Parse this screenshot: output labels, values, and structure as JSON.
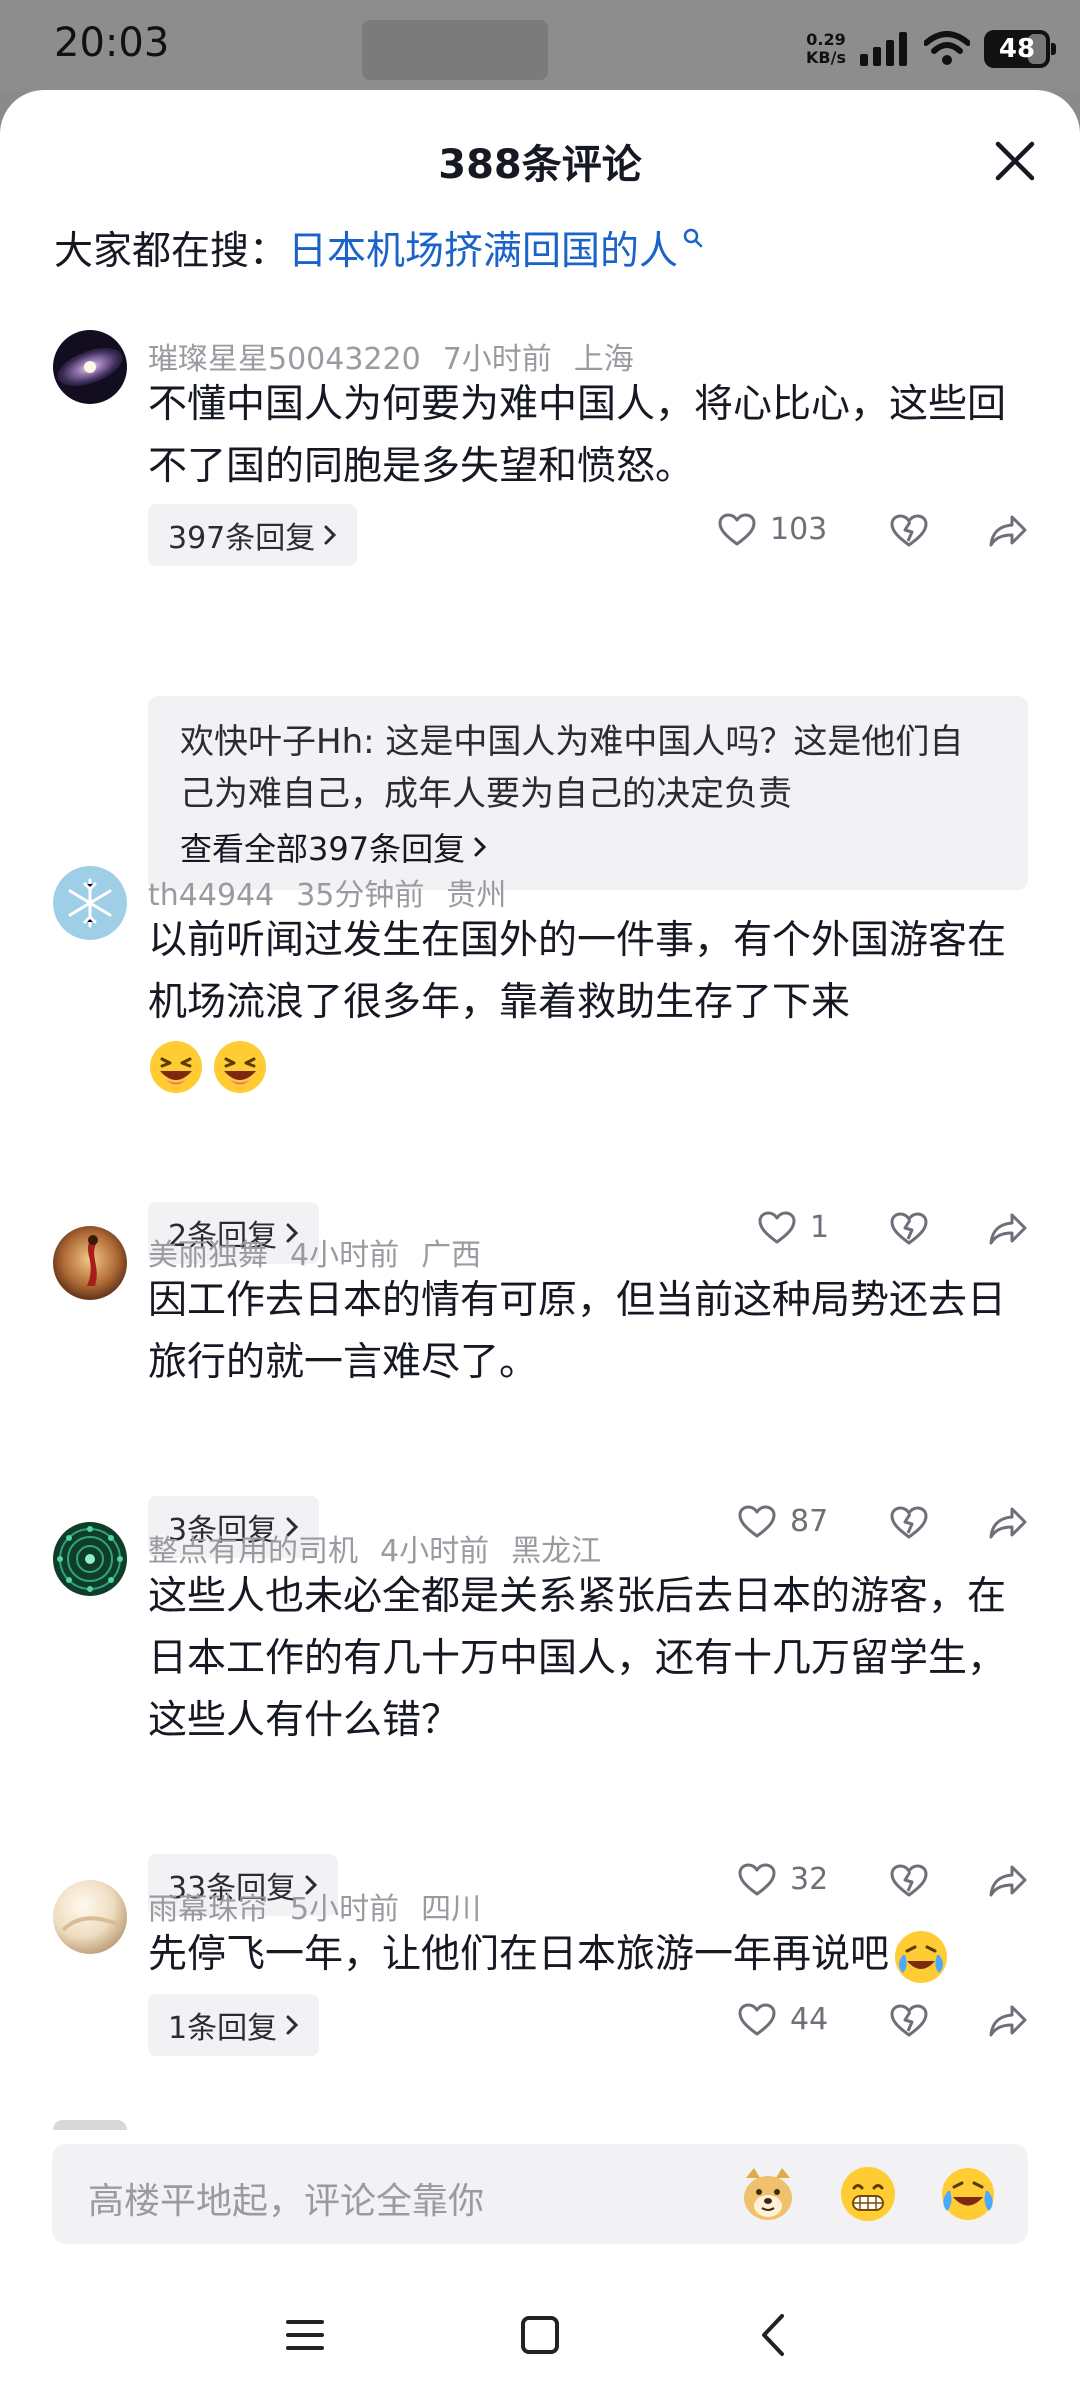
{
  "status_bar": {
    "time": "20:03",
    "net_speed_value": "0.29",
    "net_speed_unit": "KB/s",
    "battery": "48"
  },
  "sheet": {
    "title": "388条评论",
    "hot_search_label": "大家都在搜：",
    "hot_search_query": "日本机场挤满回国的人"
  },
  "comments": [
    {
      "user": "璀璨星星50043220",
      "time": "7小时前",
      "location": "上海",
      "text": "不懂中国人为何要为难中国人，将心比心，这些回不了国的同胞是多失望和愤怒。",
      "reply_label": "397条回复",
      "likes": "103",
      "avatar": "galaxy",
      "sub_reply": {
        "author": "欢快叶子Hh",
        "text": "这是中国人为难中国人吗？这是他们自己为难自己，成年人要为自己的决定负责",
        "see_all": "查看全部397条回复"
      }
    },
    {
      "user": "th44944",
      "time": "35分钟前",
      "location": "贵州",
      "text": "以前听闻过发生在国外的一件事，有个外国游客在机场流浪了很多年，靠着救助生存了下来",
      "emojis": [
        "laughing-emoji",
        "laughing-emoji"
      ],
      "reply_label": "2条回复",
      "likes": "1",
      "avatar": "snowflake"
    },
    {
      "user": "美丽独舞",
      "time": "4小时前",
      "location": "广西",
      "text": "因工作去日本的情有可原，但当前这种局势还去日旅行的就一言难尽了。",
      "reply_label": "3条回复",
      "likes": "87",
      "avatar": "dancer"
    },
    {
      "user": "整点有用的司机",
      "time": "4小时前",
      "location": "黑龙江",
      "text": "这些人也未必全都是关系紧张后去日本的游客，在日本工作的有几十万中国人，还有十几万留学生，这些人有什么错？",
      "reply_label": "33条回复",
      "likes": "32",
      "avatar": "mandala"
    },
    {
      "user": "雨幕珠帘",
      "time": "5小时前",
      "location": "四川",
      "text": "先停飞一年，让他们在日本旅游一年再说吧",
      "trailing_emoji": "crying-laugh-emoji",
      "reply_label": "1条回复",
      "likes": "44",
      "avatar": "cream"
    }
  ],
  "input_bar": {
    "placeholder": "高楼平地起，评论全靠你",
    "quick_emojis": [
      "doge-emoji",
      "grin-emoji",
      "crying-laugh-emoji"
    ]
  },
  "colors": {
    "link": "#1a63c9",
    "meta": "#9a9ba1",
    "chip_bg": "#f2f2f4"
  }
}
